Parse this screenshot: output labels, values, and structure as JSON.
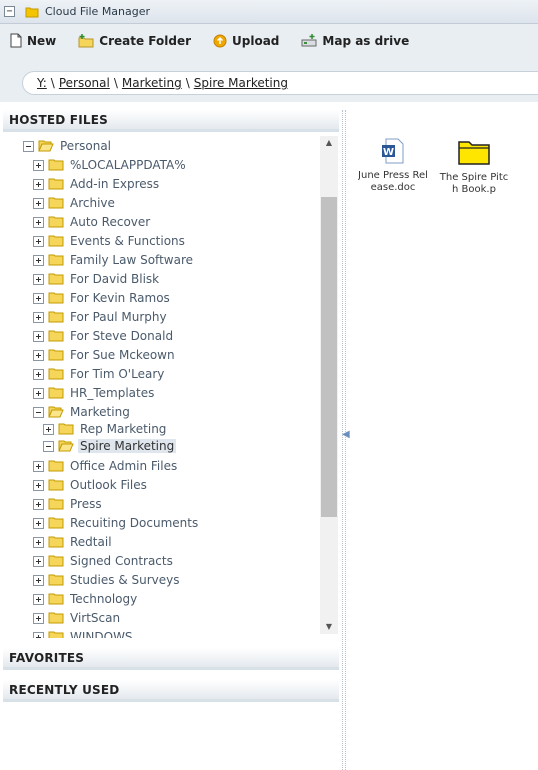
{
  "window": {
    "title": "Cloud File Manager",
    "toggle": "−"
  },
  "toolbar": {
    "new_label": "New",
    "create_folder_label": "Create Folder",
    "upload_label": "Upload",
    "map_drive_label": "Map as drive"
  },
  "address": {
    "crumbs": [
      "Y:",
      "Personal",
      "Marketing",
      "Spire Marketing"
    ],
    "separator": "\\"
  },
  "sections": {
    "hosted": "HOSTED FILES",
    "favorites": "FAVORITES",
    "recent": "RECENTLY USED"
  },
  "tree": {
    "root": "Personal",
    "folders": [
      "%LOCALAPPDATA%",
      "Add-in Express",
      "Archive",
      "Auto Recover",
      "Events & Functions",
      "Family Law Software",
      "For David Blisk",
      "For Kevin Ramos",
      "For Paul Murphy",
      "For Steve Donald",
      "For Sue Mckeown",
      "For Tim O'Leary",
      "HR_Templates",
      "Marketing"
    ],
    "marketing_children": [
      "Rep Marketing",
      "Spire Marketing"
    ],
    "folders_after": [
      "Office Admin Files",
      "Outlook Files",
      "Press",
      "Recuiting Documents",
      "Redtail",
      "Signed Contracts",
      "Studies & Surveys",
      "Technology",
      "VirtScan",
      "WINDOWS"
    ],
    "selected": "Spire Marketing"
  },
  "files": [
    {
      "name": "June Press Release.doc",
      "icon": "word-doc-icon"
    },
    {
      "name": "The Spire Pitch Book.p",
      "icon": "folder-icon"
    }
  ],
  "colors": {
    "folder": "#f5c400",
    "accent": "#2b5797",
    "selected_bg": "#dfe6ee"
  }
}
